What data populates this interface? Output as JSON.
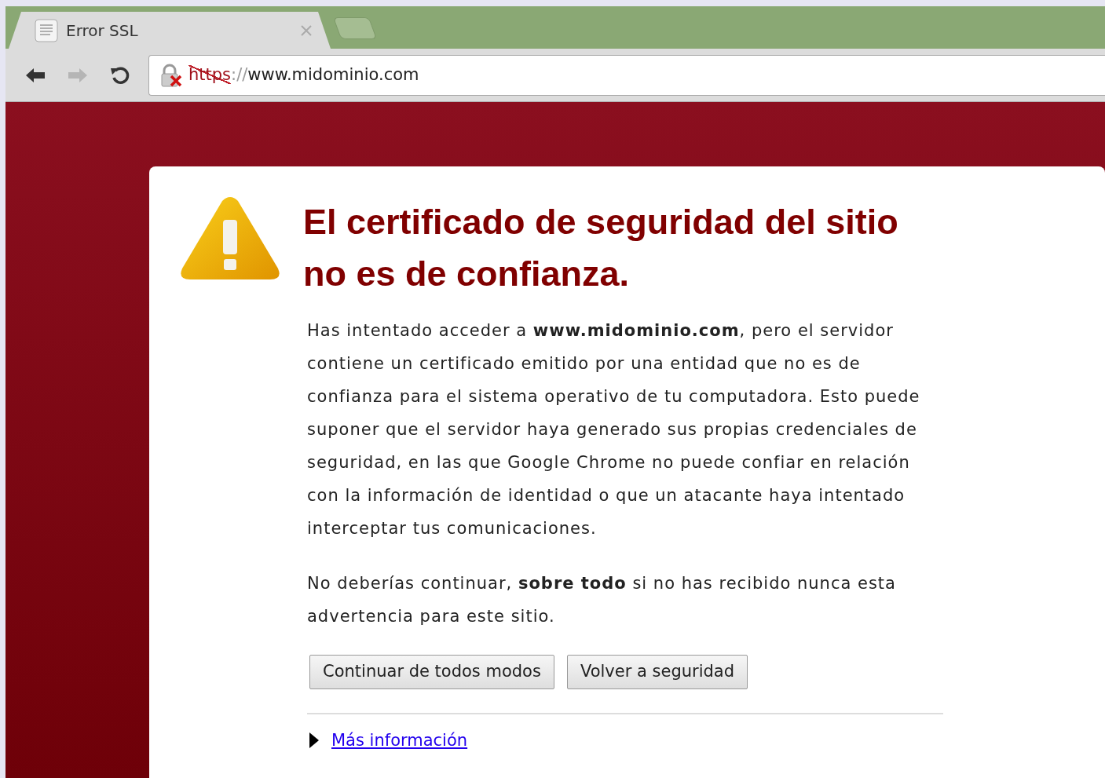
{
  "browser": {
    "tabs": [
      {
        "title": "Error SSL",
        "selected": true
      }
    ],
    "nav": {
      "back_disabled": false,
      "forward_disabled": true
    },
    "address": {
      "scheme": "https",
      "separator": "://",
      "host": "www.midominio.com",
      "insecure": true
    }
  },
  "page": {
    "heading": "El certificado de seguridad del sitio no es de confianza.",
    "paragraphs": [
      "Has intentado acceder a **www.midominio.com**, pero el servidor contiene un certificado emitido por una entidad que no es de confianza para el sistema operativo de tu computadora. Esto puede suponer que el servidor haya generado sus propias credenciales de seguridad, en las que Google Chrome no puede confiar en relación con la información de identidad o que un atacante haya intentado interceptar tus comunicaciones.",
      "No deberías continuar, **sobre todo** si no has recibido nunca esta advertencia para este sitio."
    ],
    "buttons": [
      "Continuar de todos modos",
      "Volver a seguridad"
    ],
    "more_info": {
      "label": "Más información",
      "expanded": false
    }
  }
}
